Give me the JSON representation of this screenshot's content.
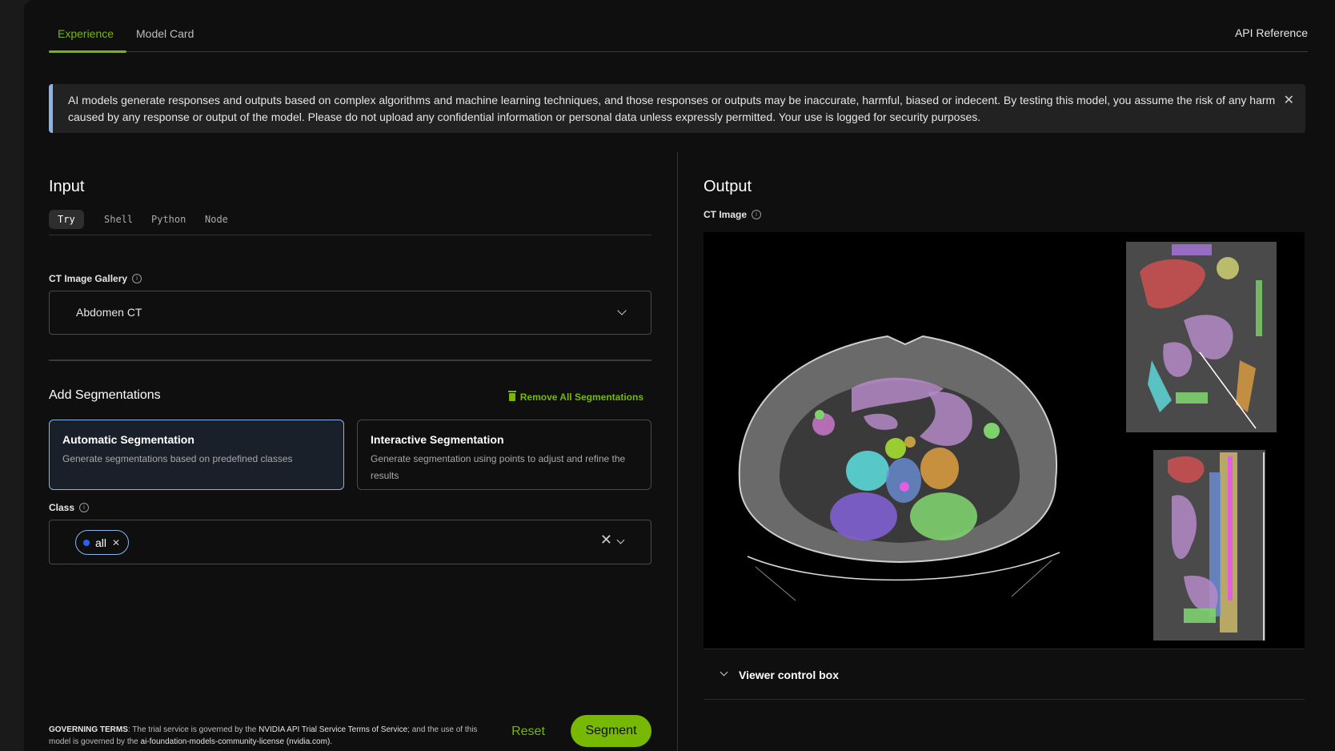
{
  "tabs": {
    "experience": "Experience",
    "model_card": "Model Card",
    "api_reference": "API Reference"
  },
  "banner": {
    "text": "AI models generate responses and outputs based on complex algorithms and machine learning techniques, and those responses or outputs may be inaccurate, harmful, biased or indecent. By testing this model, you assume the risk of any harm caused by any response or output of the model. Please do not upload any confidential information or personal data unless expressly permitted. Your use is logged for security purposes.",
    "close": "✕",
    "accent_color": "#8ab4e8"
  },
  "input": {
    "title": "Input",
    "code_tabs": [
      "Try",
      "Shell",
      "Python",
      "Node"
    ],
    "gallery_label": "CT Image Gallery",
    "gallery_value": "Abdomen CT",
    "add_seg_title": "Add Segmentations",
    "remove_all": "Remove All Segmentations",
    "auto_seg": {
      "title": "Automatic Segmentation",
      "desc": "Generate segmentations based on predefined classes"
    },
    "interactive_seg": {
      "title": "Interactive Segmentation",
      "desc": "Generate segmentation using points to adjust and refine the results"
    },
    "class_label": "Class",
    "class_chip": "all",
    "chip_x": "✕",
    "clear_x": "✕"
  },
  "footer": {
    "terms_head": "GOVERNING TERMS",
    "terms_1": ": The trial service is governed by the ",
    "terms_link1": "NVIDIA API Trial Service Terms of Service",
    "terms_2": "; and the use of this model is governed by the ",
    "terms_link2": "ai-foundation-models-community-license (nvidia.com)",
    "terms_3": ".",
    "reset": "Reset",
    "segment": "Segment"
  },
  "output": {
    "title": "Output",
    "image_label": "CT Image",
    "viewer_control": "Viewer control box"
  },
  "colors": {
    "brand_green": "#76b900",
    "background": "#0f0f0f"
  },
  "icons": {
    "info": "ⓘ",
    "close": "close-icon",
    "chevron": "chevron-down-icon",
    "trash": "trash-icon"
  }
}
